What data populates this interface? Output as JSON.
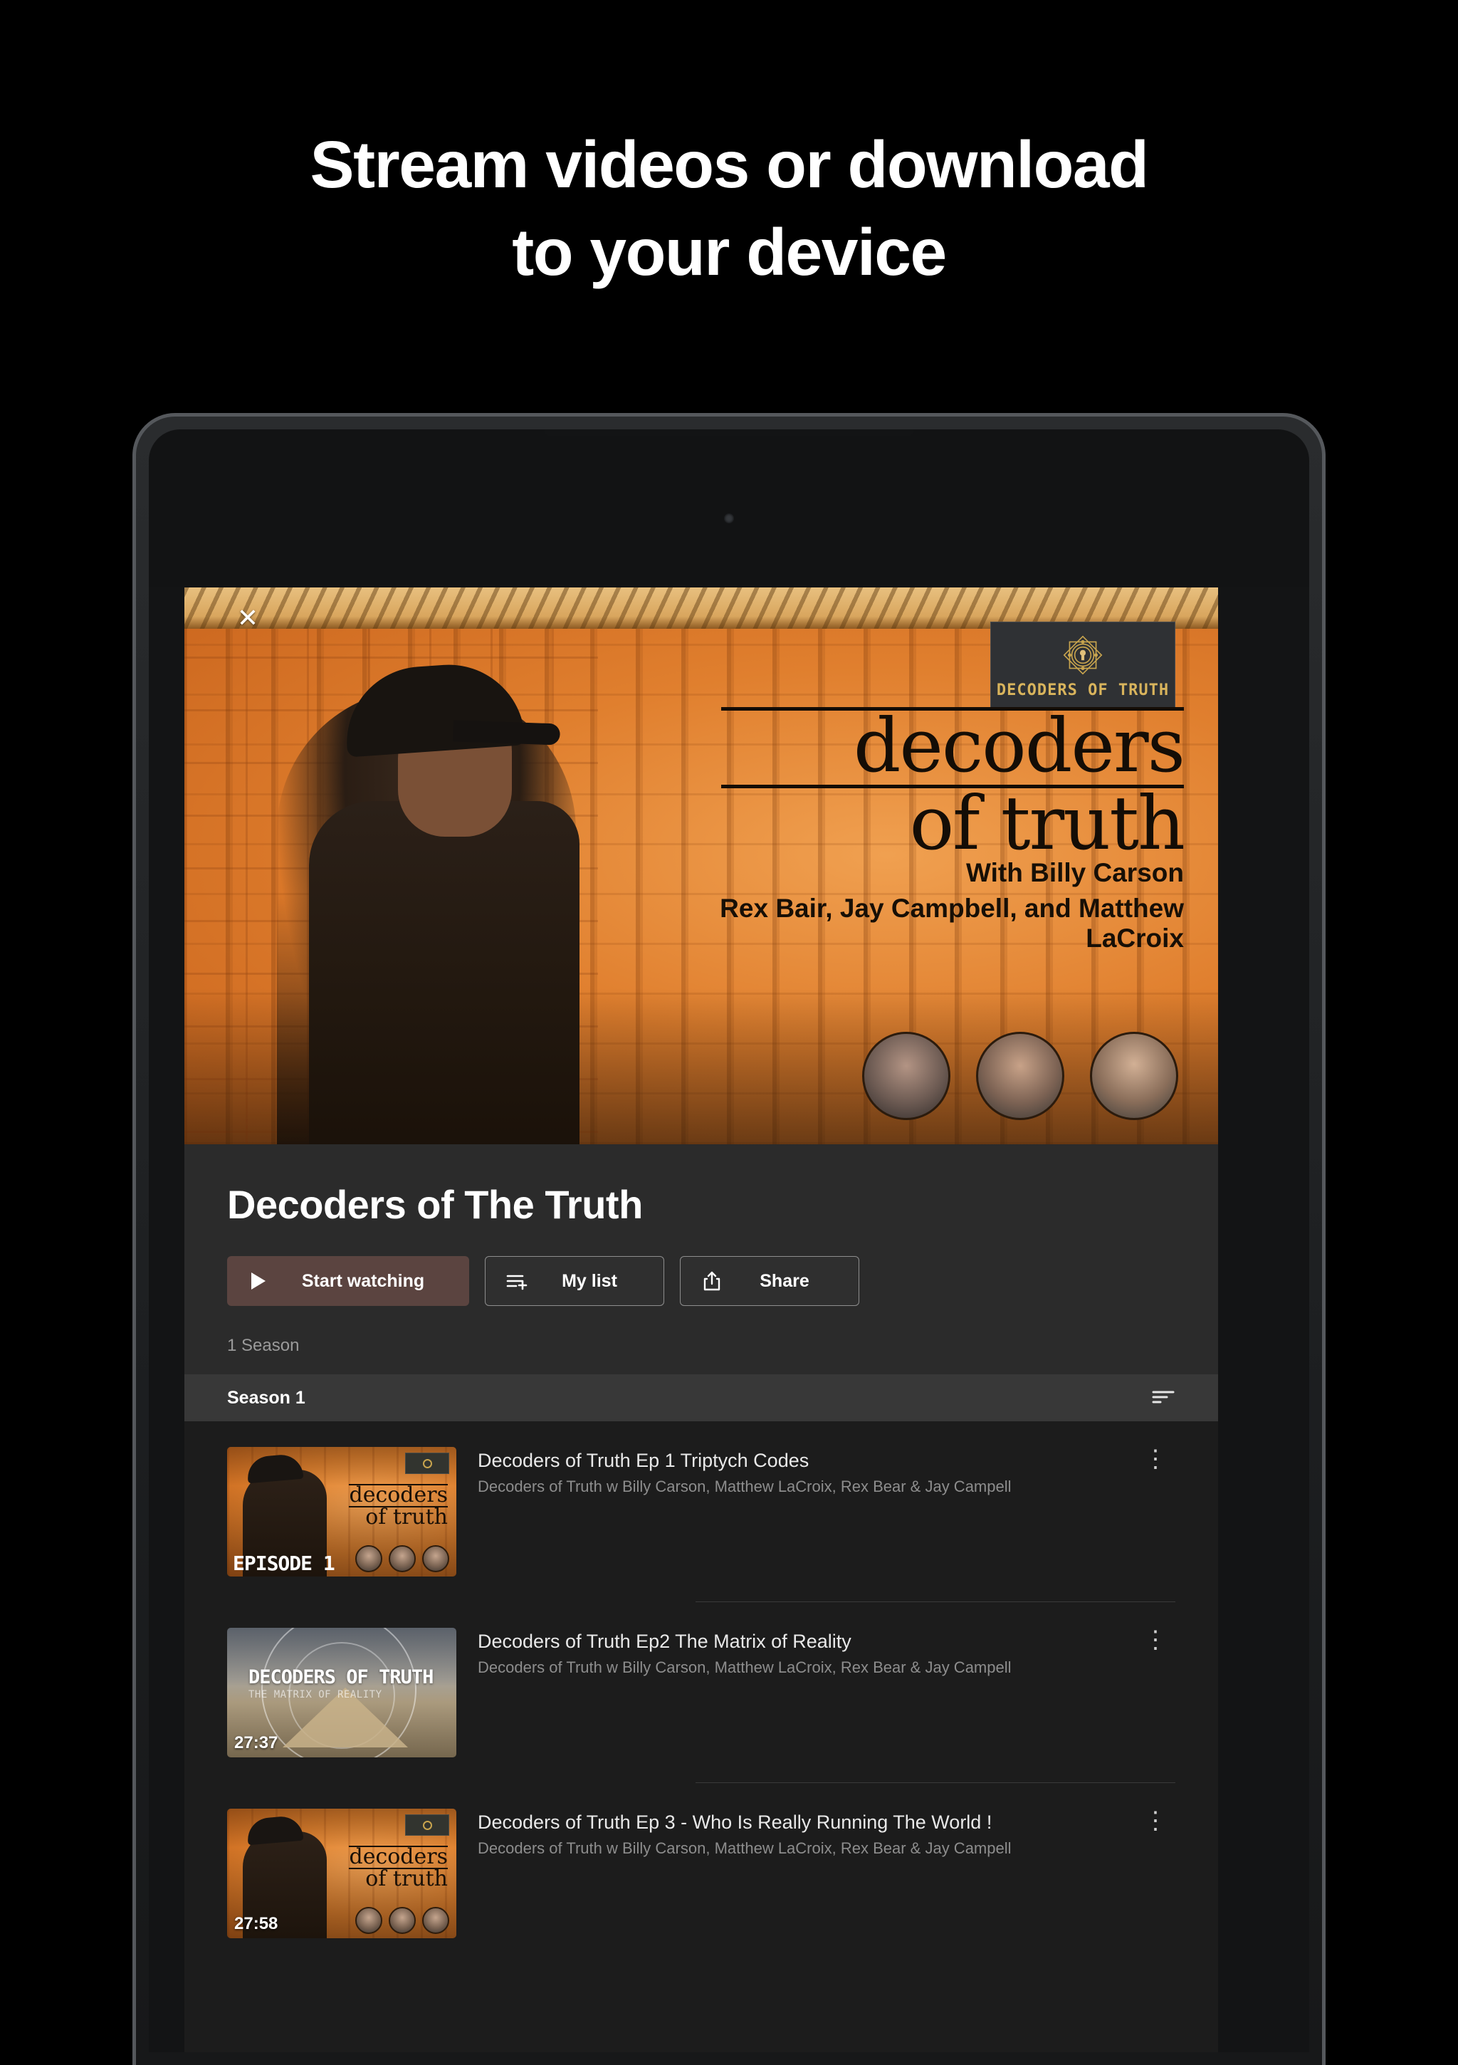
{
  "marketing": {
    "headline_line1": "Stream videos or download",
    "headline_line2": "to your device"
  },
  "hero": {
    "close_icon": "close-icon",
    "logo_line1": "decoders",
    "logo_line2": "of truth",
    "credit_host": "With Billy Carson",
    "credit_guests": "Rex Bair, Jay Campbell, and Matthew LaCroix",
    "badge_text": "DECODERS OF TRUTH"
  },
  "detail": {
    "show_title": "Decoders of The Truth",
    "start_watching_label": "Start watching",
    "my_list_label": "My list",
    "share_label": "Share",
    "season_count": "1 Season"
  },
  "season_bar": {
    "label": "Season 1",
    "sort_icon": "sort-icon"
  },
  "episodes": [
    {
      "title": "Decoders of Truth Ep 1 Triptych Codes",
      "subtitle": "Decoders of Truth w Billy Carson, Matthew LaCroix, Rex Bear & Jay Campell",
      "duration": "",
      "thumb_label": "EPISODE 1",
      "thumb_script1": "decoders",
      "thumb_script2": "of truth",
      "more_icon": "more-vertical-icon"
    },
    {
      "title": "Decoders of Truth Ep2  The Matrix of Reality",
      "subtitle": "Decoders of Truth w Billy Carson, Matthew LaCroix, Rex Bear & Jay Campell",
      "duration": "27:37",
      "thumb_title": "DECODERS OF TRUTH",
      "thumb_sub": "THE MATRIX OF REALITY",
      "more_icon": "more-vertical-icon"
    },
    {
      "title": "Decoders of Truth Ep 3 - Who Is Really Running The World !",
      "subtitle": "Decoders of Truth w Billy Carson, Matthew LaCroix, Rex Bear & Jay Campell",
      "duration": "27:58",
      "thumb_script1": "decoders",
      "thumb_script2": "of truth",
      "more_icon": "more-vertical-icon"
    }
  ],
  "colors": {
    "page_background": "#000000",
    "modal_background": "#1c1c1c",
    "detail_background": "#2b2b2b",
    "primary_button": "#5b4440",
    "season_bar": "#383838",
    "accent_gold": "#d9b45c",
    "hero_orange": "#e07f2e"
  }
}
